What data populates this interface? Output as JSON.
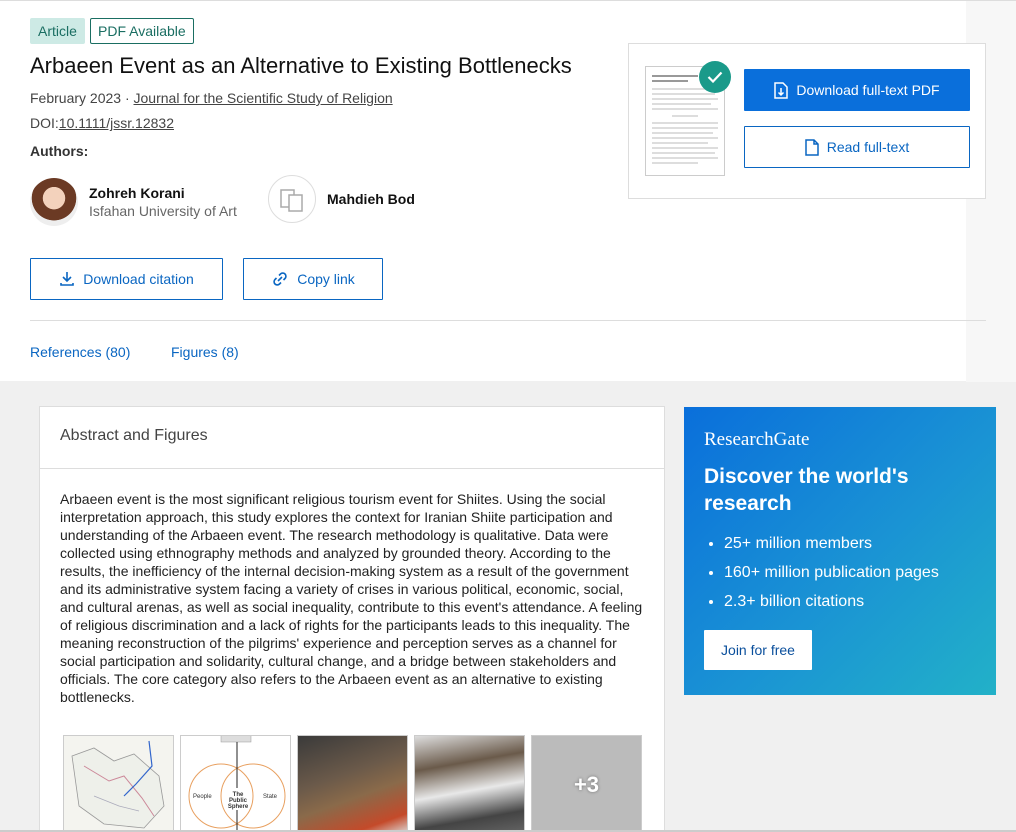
{
  "badges": {
    "article": "Article",
    "pdf": "PDF Available"
  },
  "paper": {
    "title": "Arbaeen Event as an Alternative to Existing Bottlenecks",
    "date": "February 2023",
    "separator": "·",
    "journal": "Journal for the Scientific Study of Religion",
    "doi_label": "DOI:",
    "doi": "10.1111/jssr.12832"
  },
  "authors": {
    "label": "Authors:",
    "list": [
      {
        "name": "Zohreh Korani",
        "affiliation": "Isfahan University of Art"
      },
      {
        "name": "Mahdieh Bod",
        "affiliation": ""
      }
    ]
  },
  "actions": {
    "download_citation": "Download citation",
    "copy_link": "Copy link"
  },
  "tabs": [
    {
      "label": "References (80)"
    },
    {
      "label": "Figures (8)"
    }
  ],
  "pdf_card": {
    "download_label": "Download full-text PDF",
    "read_label": "Read full-text"
  },
  "abstract": {
    "heading": "Abstract and Figures",
    "text": "Arbaeen event is the most significant religious tourism event for Shiites. Using the social interpretation approach, this study explores the context for Iranian Shiite participation and understanding of the Arbaeen event. The research methodology is qualitative. Data were collected using ethnography methods and analyzed by grounded theory. According to the results, the inefficiency of the internal decision-making system as a result of the government and its administrative system facing a variety of crises in various political, economic, social, and cultural arenas, as well as social inequality, contribute to this event's attendance. A feeling of religious discrimination and a lack of rights for the participants leads to this inequality. The meaning reconstruction of the pilgrims' experience and perception serves as a channel for social participation and solidarity, cultural change, and a bridge between stakeholders and officials. The core category also refers to the Arbaeen event as an alternative to existing bottlenecks.",
    "figures_more": "+3",
    "venn": {
      "left": "People",
      "center": "The Public Sphere",
      "right": "State"
    }
  },
  "researchgate": {
    "logo": "ResearchGate",
    "heading": "Discover the world's research",
    "stats": [
      "25+ million members",
      "160+ million publication pages",
      "2.3+ billion citations"
    ],
    "join_label": "Join for free"
  },
  "colors": {
    "link": "#0a66c2",
    "primary": "#0a6fdb",
    "teal": "#1a6e62"
  }
}
